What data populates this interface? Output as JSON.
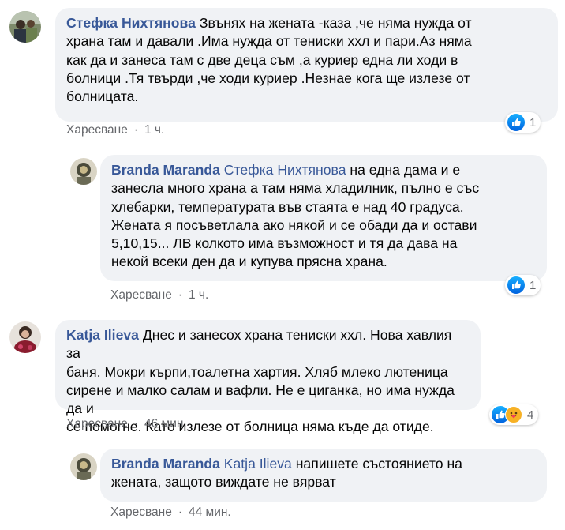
{
  "comments": [
    {
      "author": "Стефка Нихтянова",
      "lines": [
        "Звънях на жената -каза ,че няма нужда от",
        "храна там и давали .Има нужда от тениски ххл и пари.Аз няма",
        "как да и занеса там с две деца съм ,а куриер една ли ходи в",
        "болници .Тя твърди ,че ходи куриер .Незнае кога ще излезе от",
        "болницата."
      ],
      "like_label": "Харесване",
      "separator": "·",
      "time": "1 ч.",
      "reaction_count": "1",
      "reaction_icons": [
        "like-icon"
      ]
    },
    {
      "author": "Branda Maranda",
      "mention": "Стефка Нихтянова",
      "lines": [
        "на една дама и е",
        "занесла много храна а там няма хладилник, пълно е със",
        "хлебарки, температурата във стаята е над 40 градуса.",
        "Жената я посъветлала ако някой и се обади да и остави",
        "5,10,15... ЛВ колкото има възможност и тя да дава на",
        "некой всеки ден да и купува прясна храна."
      ],
      "like_label": "Харесване",
      "separator": "·",
      "time": "1 ч.",
      "reaction_count": "1",
      "reaction_icons": [
        "like-icon"
      ]
    },
    {
      "author": "Katja Ilieva",
      "lines": [
        "Днес и занесох храна тениски ххл. Нова хавлия за",
        "баня. Мокри кърпи,тоалетна хартия. Хляб млеко лютеница",
        "сирене и малко салам и вафли. Не е циганка, но има нужда да и",
        "се помогне. Като излезе от болница няма къде да отиде."
      ],
      "like_label": "Харесване",
      "separator": "·",
      "time": "46 мин.",
      "reaction_count": "4",
      "reaction_icons": [
        "like-icon",
        "care-icon"
      ]
    },
    {
      "author": "Branda Maranda",
      "mention": "Katja Ilieva",
      "lines": [
        "напишете състоянието на",
        "жената, защото виждате не вярват"
      ],
      "like_label": "Харесване",
      "separator": "·",
      "time": "44 мин."
    }
  ],
  "colors": {
    "bubble": "#f0f2f5",
    "author": "#385898",
    "meta": "#65676b",
    "like_blue": "#1877f2"
  }
}
